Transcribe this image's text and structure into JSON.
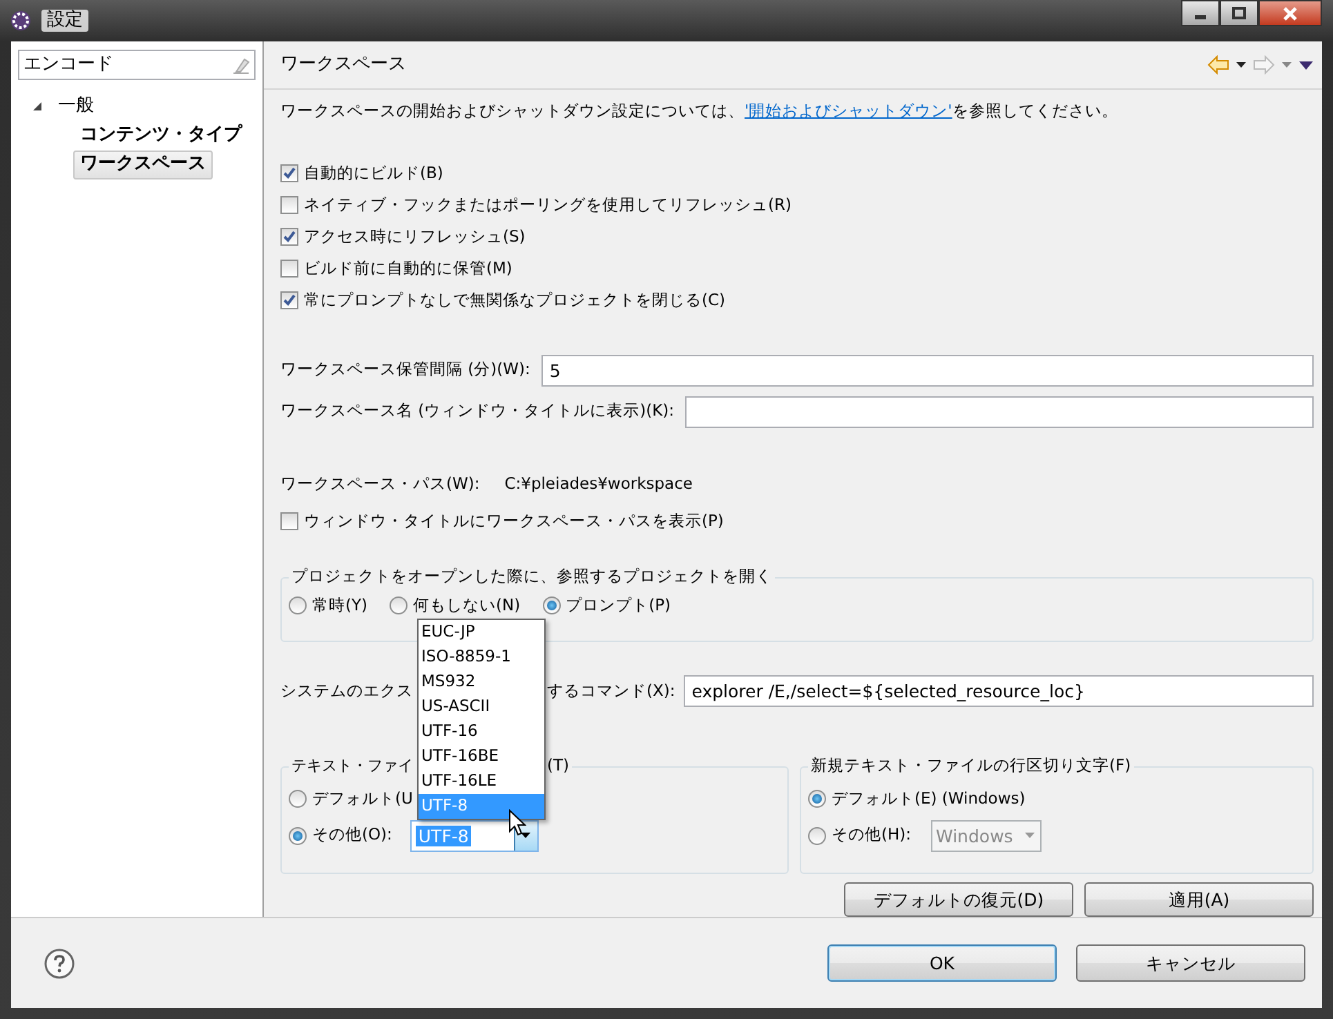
{
  "window": {
    "title": "設定"
  },
  "sidebar": {
    "filter": {
      "value": "エンコード"
    },
    "tree": [
      {
        "label": "一般",
        "expanded": true,
        "selected": false,
        "children": [
          {
            "label": "コンテンツ・タイプ",
            "selected": false
          },
          {
            "label": "ワークスペース",
            "selected": true
          }
        ]
      }
    ]
  },
  "page": {
    "title": "ワークスペース",
    "description": {
      "before": "ワークスペースの開始およびシャットダウン設定については、",
      "link": "'開始およびシャットダウン'",
      "after": " を参照してください。"
    },
    "checkboxes": [
      {
        "label": "自動的にビルド(B)",
        "checked": true
      },
      {
        "label": "ネイティブ・フックまたはポーリングを使用してリフレッシュ(R)",
        "checked": false
      },
      {
        "label": "アクセス時にリフレッシュ(S)",
        "checked": true
      },
      {
        "label": "ビルド前に自動的に保管(M)",
        "checked": false
      },
      {
        "label": "常にプロンプトなしで無関係なプロジェクトを閉じる(C)",
        "checked": true
      }
    ],
    "fields": [
      {
        "label": "ワークスペース保管間隔 (分)(W):",
        "value": "5"
      },
      {
        "label": "ワークスペース名 (ウィンドウ・タイトルに表示)(K):"
      }
    ],
    "path": {
      "label": "ワークスペース・パス(W):",
      "value": "C:¥pleiades¥workspace"
    },
    "show_path": {
      "label": "ウィンドウ・タイトルにワークスペース・パスを表示(P)",
      "checked": false
    },
    "open_projects": {
      "title": "プロジェクトをオープンした際に、参照するプロジェクトを開く",
      "options": [
        {
          "label": "常時(Y)",
          "selected": false
        },
        {
          "label": "何もしない(N)",
          "selected": false
        },
        {
          "label": "プロンプト(P)",
          "selected": true
        }
      ]
    },
    "command": {
      "label_parts": [
        "システムのエクス",
        "するコマンド(X):"
      ],
      "value": "explorer /E,/select=${selected_resource_loc}"
    },
    "encoding": {
      "title_parts": [
        "テキスト・ファイ",
        "(T)"
      ],
      "options": [
        {
          "label": "デフォルト(U",
          "selected": false
        },
        {
          "label": "その他(O):",
          "selected": true
        }
      ],
      "combo": {
        "value": "UTF-8"
      }
    },
    "line_delimiter": {
      "title": "新規テキスト・ファイルの行区切り文字(F)",
      "options": [
        {
          "label": "デフォルト(E) (Windows)",
          "selected": true
        },
        {
          "label": "その他(H):",
          "selected": false
        }
      ],
      "combo": {
        "value": "Windows",
        "disabled": true
      }
    },
    "dropdown": {
      "items": [
        {
          "label": "EUC-JP",
          "selected": false
        },
        {
          "label": "ISO-8859-1",
          "selected": false
        },
        {
          "label": "MS932",
          "selected": false
        },
        {
          "label": "US-ASCII",
          "selected": false
        },
        {
          "label": "UTF-16",
          "selected": false
        },
        {
          "label": "UTF-16BE",
          "selected": false
        },
        {
          "label": "UTF-16LE",
          "selected": false
        },
        {
          "label": "UTF-8",
          "selected": true
        }
      ]
    },
    "buttons": [
      "デフォルトの復元(D)",
      "適用(A)"
    ]
  },
  "footer": {
    "buttons": [
      {
        "label": "OK",
        "default": true
      },
      {
        "label": "キャンセル",
        "default": false
      }
    ]
  }
}
